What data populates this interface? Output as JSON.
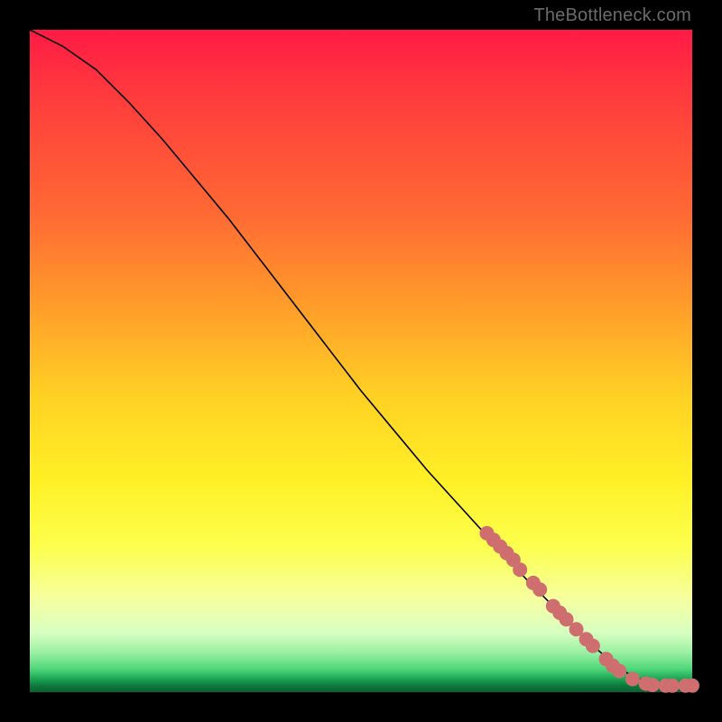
{
  "attribution": "TheBottleneck.com",
  "colors": {
    "curve_stroke": "#000000",
    "marker_fill": "#cf6e6e",
    "marker_stroke": "#8e3a3a"
  },
  "chart_data": {
    "type": "line",
    "title": "",
    "xlabel": "",
    "ylabel": "",
    "xlim": [
      0,
      100
    ],
    "ylim": [
      0,
      100
    ],
    "note": "Axes have no visible tick labels; values are in percent of plot area (x left→right, y bottom→top).",
    "series": [
      {
        "name": "curve",
        "x": [
          0,
          2,
          5,
          10,
          15,
          20,
          25,
          30,
          35,
          40,
          45,
          50,
          55,
          60,
          65,
          70,
          75,
          80,
          85,
          88,
          90,
          92,
          94,
          96,
          98,
          100
        ],
        "y": [
          100,
          99,
          97.5,
          94,
          89,
          83.5,
          77.5,
          71.5,
          65,
          58.5,
          52,
          45.5,
          39.5,
          33.5,
          28,
          22.5,
          17,
          12,
          7,
          4.5,
          3,
          2,
          1.4,
          1.1,
          1,
          1
        ]
      }
    ],
    "markers": {
      "name": "highlighted-points",
      "points": [
        {
          "x": 69,
          "y": 24
        },
        {
          "x": 70,
          "y": 23
        },
        {
          "x": 71,
          "y": 22
        },
        {
          "x": 72,
          "y": 21
        },
        {
          "x": 73,
          "y": 20
        },
        {
          "x": 74,
          "y": 18.5
        },
        {
          "x": 76,
          "y": 16.5
        },
        {
          "x": 77,
          "y": 15.5
        },
        {
          "x": 79,
          "y": 13
        },
        {
          "x": 80,
          "y": 12
        },
        {
          "x": 81,
          "y": 11
        },
        {
          "x": 82.5,
          "y": 9.5
        },
        {
          "x": 84,
          "y": 8
        },
        {
          "x": 85,
          "y": 7
        },
        {
          "x": 87,
          "y": 5
        },
        {
          "x": 88,
          "y": 4
        },
        {
          "x": 89,
          "y": 3.2
        },
        {
          "x": 91,
          "y": 2
        },
        {
          "x": 93,
          "y": 1.3
        },
        {
          "x": 94,
          "y": 1.1
        },
        {
          "x": 96,
          "y": 1
        },
        {
          "x": 97,
          "y": 1
        },
        {
          "x": 99,
          "y": 1
        },
        {
          "x": 100,
          "y": 1
        }
      ]
    }
  }
}
